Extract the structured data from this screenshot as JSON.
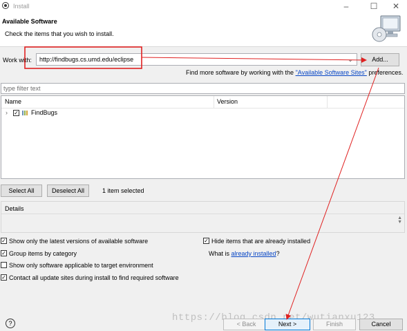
{
  "window": {
    "title": "Install",
    "minimize": "–",
    "maximize": "☐",
    "close": "✕"
  },
  "header": {
    "title": "Available Software",
    "subtitle": "Check the items that you wish to install."
  },
  "work_with": {
    "label": "Work with:",
    "value": "http://findbugs.cs.umd.edu/eclipse",
    "add_button": "Add..."
  },
  "find_more": {
    "prefix": "Find more software by working with the ",
    "link": "\"Available Software Sites\"",
    "suffix": " preferences."
  },
  "filter": {
    "placeholder": "type filter text"
  },
  "table": {
    "columns": [
      "Name",
      "Version"
    ],
    "rows": [
      {
        "name": "FindBugs",
        "checked": true,
        "version": ""
      }
    ]
  },
  "selection": {
    "select_all": "Select All",
    "deselect_all": "Deselect All",
    "status": "1 item selected"
  },
  "details": {
    "label": "Details"
  },
  "options": {
    "latest_versions": {
      "label": "Show only the latest versions of available software",
      "checked": true
    },
    "group_by_category": {
      "label": "Group items by category",
      "checked": true
    },
    "target_env": {
      "label": "Show only software applicable to target environment",
      "checked": false
    },
    "contact_sites": {
      "label": "Contact all update sites during install to find required software",
      "checked": true
    },
    "hide_installed": {
      "label": "Hide items that are already installed",
      "checked": true
    },
    "what_is": {
      "prefix": "What is ",
      "link": "already installed",
      "suffix": "?"
    }
  },
  "footer": {
    "help": "?",
    "back": "< Back",
    "next": "Next >",
    "finish": "Finish",
    "cancel": "Cancel"
  },
  "watermark": "https://blog.csdn.net/wutianxu123",
  "colors": {
    "annotation_red": "#e02020",
    "link_blue": "#0645c5",
    "default_button_border": "#0078d7"
  }
}
